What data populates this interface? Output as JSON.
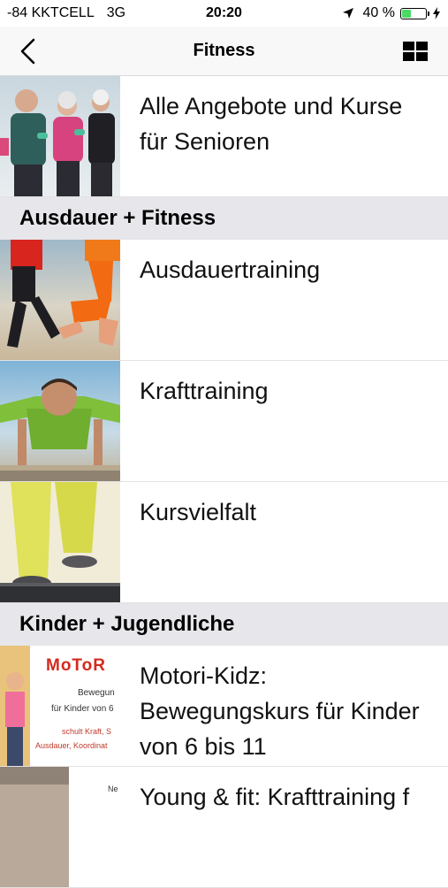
{
  "status_bar": {
    "carrier": "-84 KKTCELL",
    "network": "3G",
    "time": "20:20",
    "battery_text": "40 %",
    "battery_level": 0.4
  },
  "nav": {
    "title": "Fitness"
  },
  "items": [
    {
      "label": "Alle Angebote und Kurse für Senioren"
    }
  ],
  "sections": [
    {
      "title": "Ausdauer + Fitness",
      "items": [
        {
          "label": "Ausdauertraining"
        },
        {
          "label": "Krafttraining"
        },
        {
          "label": "Kursvielfalt"
        }
      ]
    },
    {
      "title": "Kinder + Jugendliche",
      "items": [
        {
          "label": "Motori-Kidz: Bewegungskurs für Kinder von 6 bis 11",
          "thumb_text": {
            "logo": "MoToR",
            "line1": "Bewegun",
            "line2": "für Kinder von 6",
            "line3": "schult Kraft, S",
            "line4": "Ausdauer, Koordinat"
          }
        },
        {
          "label": "Young & fit: Krafttraining f",
          "thumb_text": {
            "line1": "Ne"
          }
        }
      ]
    }
  ],
  "colors": {
    "section_bg": "#e6e6eb",
    "nav_bg": "#f8f8f8",
    "battery_green": "#4cd964"
  }
}
